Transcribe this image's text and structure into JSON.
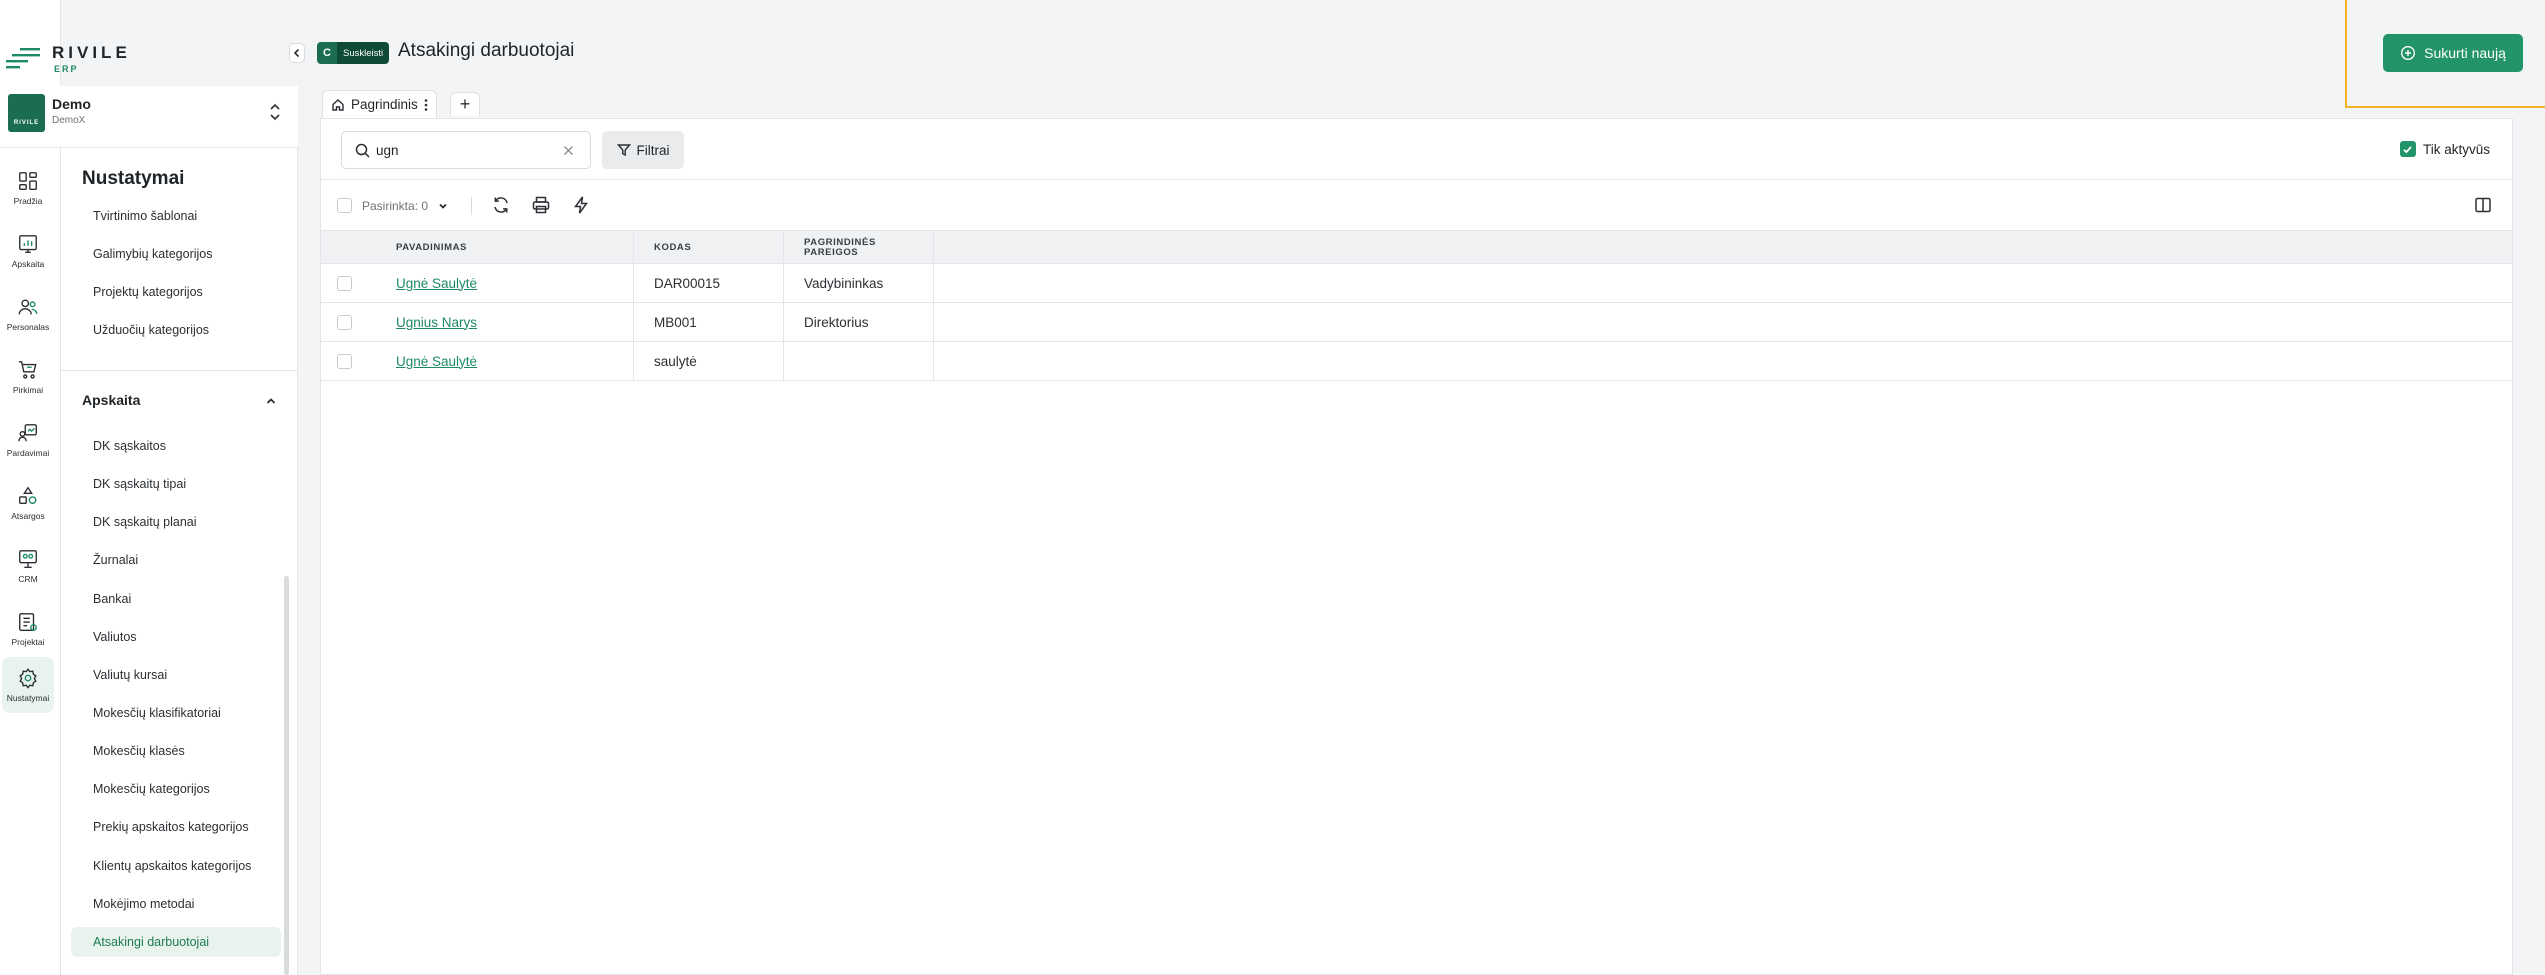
{
  "app": {
    "logo_text": "RIVILE",
    "logo_sub": "ERP",
    "brand_color": "#1a6d4f",
    "accent_color": "#23946a"
  },
  "company": {
    "name": "Demo",
    "sub": "DemoX",
    "logo_text": "RIVILE"
  },
  "rail": [
    {
      "label": "Pradžia",
      "icon": "dashboard-icon"
    },
    {
      "label": "Apskaita",
      "icon": "accounting-chart-icon"
    },
    {
      "label": "Personalas",
      "icon": "people-icon"
    },
    {
      "label": "Pirkimai",
      "icon": "cart-icon"
    },
    {
      "label": "Pardavimai",
      "icon": "sales-icon"
    },
    {
      "label": "Atsargos",
      "icon": "shapes-icon"
    },
    {
      "label": "CRM",
      "icon": "crm-icon"
    },
    {
      "label": "Projektai",
      "icon": "projects-icon"
    },
    {
      "label": "Nustatymai",
      "icon": "gear-icon",
      "active": true
    }
  ],
  "menu": {
    "title": "Nustatymai",
    "top_items": [
      "Tvirtinimo šablonai",
      "Galimybių kategorijos",
      "Projektų kategorijos",
      "Užduočių kategorijos"
    ],
    "section_title": "Apskaita",
    "section_items": [
      "DK sąskaitos",
      "DK sąskaitų tipai",
      "DK sąskaitų planai",
      "Žurnalai",
      "Bankai",
      "Valiutos",
      "Valiutų kursai",
      "Mokesčių klasifikatoriai",
      "Mokesčių klasės",
      "Mokesčių kategorijos",
      "Prekių apskaitos kategorijos",
      "Klientų apskaitos kategorijos",
      "Mokėjimo metodai",
      "Atsakingi darbuotojai"
    ],
    "active_item": "Atsakingi darbuotojai"
  },
  "header": {
    "tag_letter": "C",
    "tag_label": "Suskleisti",
    "title": "Atsakingi darbuotojai",
    "create_label": "Sukurti naują"
  },
  "tabs": {
    "main_label": "Pagrindinis",
    "add_label": "+"
  },
  "filters": {
    "search_value": "ugn",
    "filter_label": "Filtrai",
    "active_only_label": "Tik aktyvūs",
    "active_only_checked": true
  },
  "toolbar": {
    "selected_label": "Pasirinkta: 0"
  },
  "table": {
    "columns": [
      "PAVADINIMAS",
      "KODAS",
      "PAGRINDINĖS PAREIGOS"
    ],
    "rows": [
      {
        "name": "Ugnė Saulytė",
        "code": "DAR00015",
        "position": "Vadybininkas"
      },
      {
        "name": "Ugnius Narys",
        "code": "MB001",
        "position": "Direktorius"
      },
      {
        "name": "Ugnė Saulytė",
        "code": "saulytė",
        "position": ""
      }
    ]
  }
}
